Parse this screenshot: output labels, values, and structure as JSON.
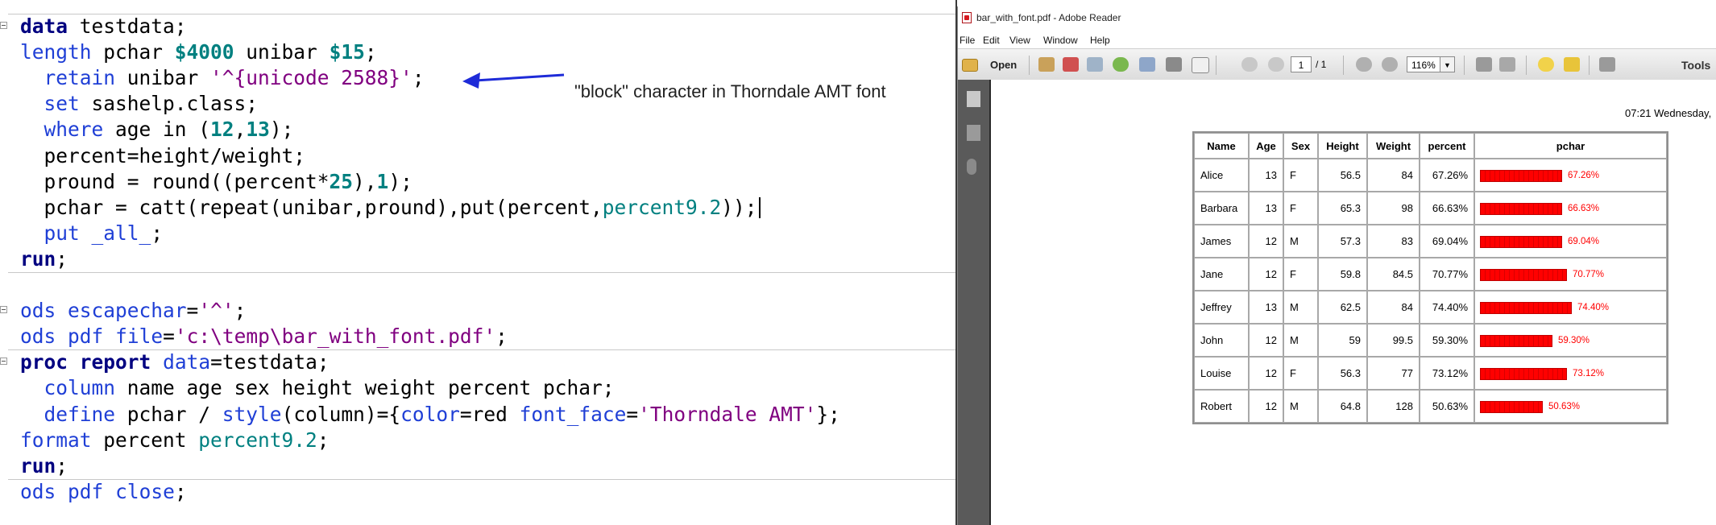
{
  "editor": {
    "lines": [
      {
        "tokens": [
          {
            "c": "kw",
            "t": "data"
          },
          {
            "t": " testdata;"
          }
        ]
      },
      {
        "tokens": [
          {
            "c": "st",
            "t": "length"
          },
          {
            "t": " pchar "
          },
          {
            "c": "num",
            "t": "$4000"
          },
          {
            "t": " unibar "
          },
          {
            "c": "num",
            "t": "$15"
          },
          {
            "t": ";"
          }
        ]
      },
      {
        "tokens": [
          {
            "t": "  "
          },
          {
            "c": "st",
            "t": "retain"
          },
          {
            "t": " unibar "
          },
          {
            "c": "str",
            "t": "'^{unicode 2588}'"
          },
          {
            "t": ";"
          }
        ]
      },
      {
        "tokens": [
          {
            "t": "  "
          },
          {
            "c": "st",
            "t": "set"
          },
          {
            "t": " sashelp.class;"
          }
        ]
      },
      {
        "tokens": [
          {
            "t": "  "
          },
          {
            "c": "st",
            "t": "where"
          },
          {
            "t": " age in ("
          },
          {
            "c": "num",
            "t": "12"
          },
          {
            "t": ","
          },
          {
            "c": "num",
            "t": "13"
          },
          {
            "t": ");"
          }
        ]
      },
      {
        "tokens": [
          {
            "t": "  percent=height/weight;"
          }
        ]
      },
      {
        "tokens": [
          {
            "t": "  pround = round((percent*"
          },
          {
            "c": "num",
            "t": "25"
          },
          {
            "t": "),"
          },
          {
            "c": "num",
            "t": "1"
          },
          {
            "t": ");"
          }
        ]
      },
      {
        "tokens": [
          {
            "t": "  pchar = catt(repeat(unibar,pround),put(percent,"
          },
          {
            "c": "fmt",
            "t": "percent9.2"
          },
          {
            "t": "));"
          }
        ]
      },
      {
        "tokens": [
          {
            "t": "  "
          },
          {
            "c": "st",
            "t": "put"
          },
          {
            "t": " "
          },
          {
            "c": "st",
            "t": "_all_"
          },
          {
            "t": ";"
          }
        ]
      },
      {
        "tokens": [
          {
            "c": "kw",
            "t": "run"
          },
          {
            "t": ";"
          }
        ]
      },
      {
        "tokens": []
      },
      {
        "tokens": [
          {
            "c": "st",
            "t": "ods"
          },
          {
            "t": " "
          },
          {
            "c": "st",
            "t": "escapechar"
          },
          {
            "t": "="
          },
          {
            "c": "str",
            "t": "'^'"
          },
          {
            "t": ";"
          }
        ]
      },
      {
        "tokens": [
          {
            "c": "st",
            "t": "ods"
          },
          {
            "t": " "
          },
          {
            "c": "st",
            "t": "pdf"
          },
          {
            "t": " "
          },
          {
            "c": "st",
            "t": "file"
          },
          {
            "t": "="
          },
          {
            "c": "str",
            "t": "'c:\\temp\\bar_with_font.pdf'"
          },
          {
            "t": ";"
          }
        ]
      },
      {
        "tokens": [
          {
            "c": "kw",
            "t": "proc"
          },
          {
            "t": " "
          },
          {
            "c": "kw",
            "t": "report"
          },
          {
            "t": " "
          },
          {
            "c": "st",
            "t": "data"
          },
          {
            "t": "=testdata;"
          }
        ]
      },
      {
        "tokens": [
          {
            "t": "  "
          },
          {
            "c": "st",
            "t": "column"
          },
          {
            "t": " name age sex height weight percent pchar;"
          }
        ]
      },
      {
        "tokens": [
          {
            "t": "  "
          },
          {
            "c": "st",
            "t": "define"
          },
          {
            "t": " pchar / "
          },
          {
            "c": "st",
            "t": "style"
          },
          {
            "t": "(column)={"
          },
          {
            "c": "st",
            "t": "color"
          },
          {
            "t": "=red "
          },
          {
            "c": "st",
            "t": "font_face"
          },
          {
            "t": "="
          },
          {
            "c": "str",
            "t": "'Thorndale AMT'"
          },
          {
            "t": "};"
          }
        ]
      },
      {
        "tokens": [
          {
            "c": "st",
            "t": "format"
          },
          {
            "t": " percent "
          },
          {
            "c": "fmt",
            "t": "percent9.2"
          },
          {
            "t": ";"
          }
        ]
      },
      {
        "tokens": [
          {
            "c": "kw",
            "t": "run"
          },
          {
            "t": ";"
          }
        ]
      },
      {
        "tokens": [
          {
            "c": "st",
            "t": "ods"
          },
          {
            "t": " "
          },
          {
            "c": "st",
            "t": "pdf"
          },
          {
            "t": " "
          },
          {
            "c": "st",
            "t": "close"
          },
          {
            "t": ";"
          }
        ]
      }
    ],
    "annotation": "\"block\" character in Thorndale AMT font"
  },
  "reader": {
    "window_title": "bar_with_font.pdf - Adobe Reader",
    "menu": [
      "File",
      "Edit",
      "View",
      "Window",
      "Help"
    ],
    "open_label": "Open",
    "page_current": "1",
    "page_total": "/ 1",
    "zoom": "116%",
    "tools_label": "Tools",
    "date_text": "07:21 Wednesday,",
    "table": {
      "headers": [
        "Name",
        "Age",
        "Sex",
        "Height",
        "Weight",
        "percent",
        "pchar"
      ],
      "rows": [
        {
          "name": "Alice",
          "age": "13",
          "sex": "F",
          "height": "56.5",
          "weight": "84",
          "percent": "67.26%",
          "fill": 0.6726
        },
        {
          "name": "Barbara",
          "age": "13",
          "sex": "F",
          "height": "65.3",
          "weight": "98",
          "percent": "66.63%",
          "fill": 0.6663
        },
        {
          "name": "James",
          "age": "12",
          "sex": "M",
          "height": "57.3",
          "weight": "83",
          "percent": "69.04%",
          "fill": 0.6904
        },
        {
          "name": "Jane",
          "age": "12",
          "sex": "F",
          "height": "59.8",
          "weight": "84.5",
          "percent": "70.77%",
          "fill": 0.7077
        },
        {
          "name": "Jeffrey",
          "age": "13",
          "sex": "M",
          "height": "62.5",
          "weight": "84",
          "percent": "74.40%",
          "fill": 0.744
        },
        {
          "name": "John",
          "age": "12",
          "sex": "M",
          "height": "59",
          "weight": "99.5",
          "percent": "59.30%",
          "fill": 0.593
        },
        {
          "name": "Louise",
          "age": "12",
          "sex": "F",
          "height": "56.3",
          "weight": "77",
          "percent": "73.12%",
          "fill": 0.7312
        },
        {
          "name": "Robert",
          "age": "12",
          "sex": "M",
          "height": "64.8",
          "weight": "128",
          "percent": "50.63%",
          "fill": 0.5063
        }
      ]
    },
    "colors": {
      "bar": "#ff0000",
      "navpane": "#5a5a5a"
    }
  }
}
